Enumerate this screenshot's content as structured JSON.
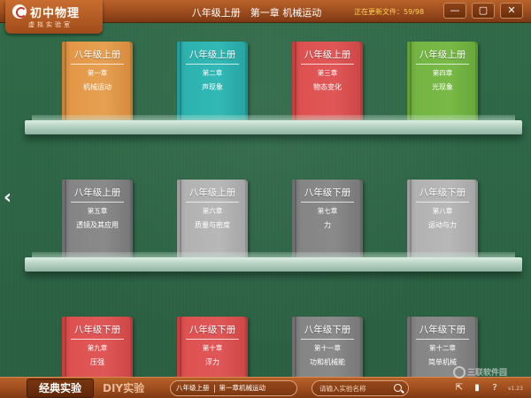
{
  "app": {
    "logo_title": "初中物理",
    "logo_subtitle": "虚拟实验室"
  },
  "header": {
    "title": "八年级上册　第一章 机械运动",
    "update_status": "正在更新文件：59/98",
    "buttons": {
      "minimize": "—",
      "maximize": "▢",
      "close": "✕"
    }
  },
  "shelves": {
    "row1": [
      {
        "grade": "八年级上册",
        "chapter": "第一章",
        "name": "机械运动",
        "color": "#e39847"
      },
      {
        "grade": "八年级上册",
        "chapter": "第二章",
        "name": "声现象",
        "color": "#2cb3b0"
      },
      {
        "grade": "八年级上册",
        "chapter": "第三章",
        "name": "物态变化",
        "color": "#de5151"
      },
      {
        "grade": "八年级上册",
        "chapter": "第四章",
        "name": "光现象",
        "color": "#74b442"
      }
    ],
    "row2": [
      {
        "grade": "八年级上册",
        "chapter": "第五章",
        "name": "透镜及其应用",
        "color": "#858585"
      },
      {
        "grade": "八年级上册",
        "chapter": "第六章",
        "name": "质量与密度",
        "color": "#b2b2b2"
      },
      {
        "grade": "八年级下册",
        "chapter": "第七章",
        "name": "力",
        "color": "#858585"
      },
      {
        "grade": "八年级下册",
        "chapter": "第八章",
        "name": "运动与力",
        "color": "#b2b2b2"
      }
    ],
    "row3": [
      {
        "grade": "八年级下册",
        "chapter": "第九章",
        "name": "压强",
        "color": "#de5151"
      },
      {
        "grade": "八年级下册",
        "chapter": "第十章",
        "name": "浮力",
        "color": "#de5151"
      },
      {
        "grade": "八年级下册",
        "chapter": "第十一章",
        "name": "功和机械能",
        "color": "#858585"
      },
      {
        "grade": "八年级下册",
        "chapter": "第十二章",
        "name": "简单机械",
        "color": "#858585"
      }
    ]
  },
  "nav": {
    "prev": "‹"
  },
  "footer": {
    "tab_classic": "经典实验",
    "tab_diy": "DIY实验",
    "crumb_grade": "八年级上册",
    "crumb_chapter": "第一章机械运动",
    "search_placeholder": "请输入实验名称",
    "version": "v1.23",
    "watermark": "三联软件园"
  }
}
